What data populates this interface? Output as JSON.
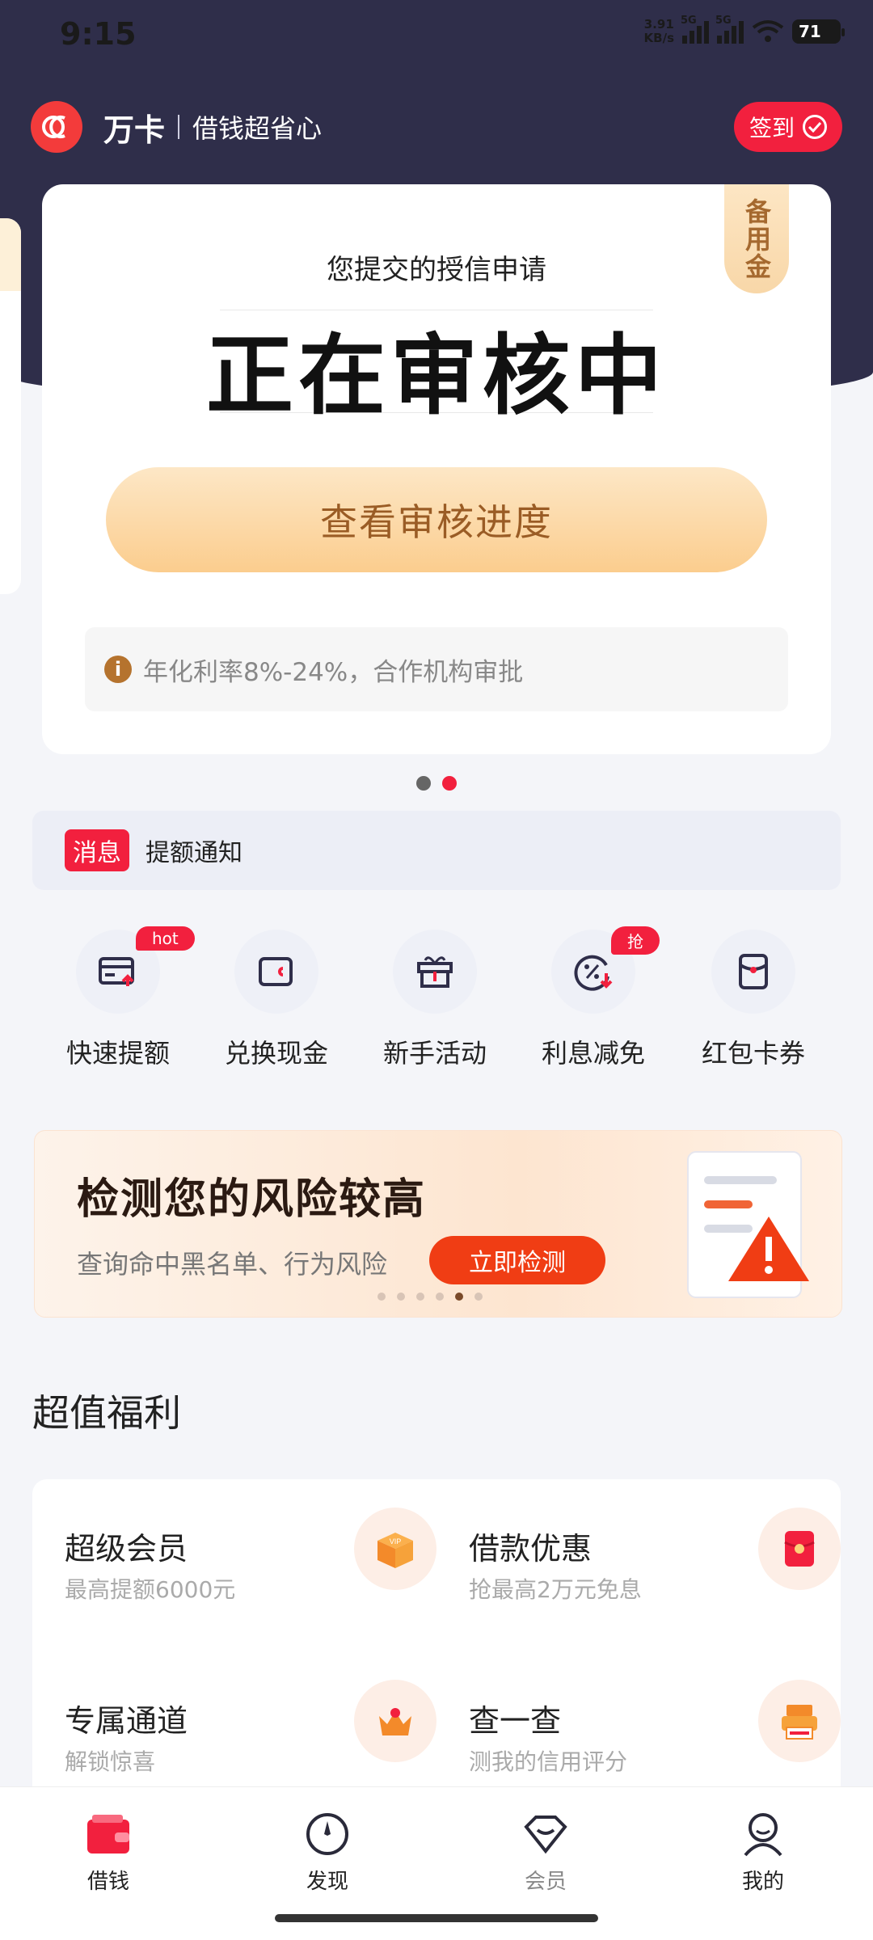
{
  "status_bar": {
    "time": "9:15",
    "net_speed": "3.91\nKB/s",
    "sim1": "5G",
    "sim2": "5G",
    "battery": "71"
  },
  "header": {
    "brand": "万卡",
    "slogan": "借钱超省心",
    "signin_label": "签到"
  },
  "card": {
    "ribbon": "备用金",
    "subtitle": "您提交的授信申请",
    "status": "正在审核中",
    "cta": "查看审核进度",
    "note": "年化利率8%-24%，合作机构审批"
  },
  "message": {
    "tag": "消息",
    "text": "提额通知"
  },
  "quick_actions": [
    {
      "label": "快速提额",
      "badge": "hot"
    },
    {
      "label": "兑换现金"
    },
    {
      "label": "新手活动"
    },
    {
      "label": "利息减免",
      "badge": "抢"
    },
    {
      "label": "红包卡券"
    }
  ],
  "banner": {
    "title": "检测您的风险较高",
    "subtitle": "查询命中黑名单、行为风险",
    "button": "立即检测",
    "dots_total": 6,
    "dot_active": 5
  },
  "section_title": "超值福利",
  "benefits": [
    {
      "title": "超级会员",
      "desc": "最高提额6000元",
      "icon": "vip-box-icon"
    },
    {
      "title": "借款优惠",
      "desc": "抢最高2万元免息",
      "icon": "red-envelope-icon"
    },
    {
      "title": "专属通道",
      "desc": "解锁惊喜",
      "icon": "crown-icon"
    },
    {
      "title": "查一查",
      "desc": "测我的信用评分",
      "icon": "credit-report-icon"
    }
  ],
  "tabs": [
    {
      "label": "借钱",
      "icon": "wallet-icon",
      "active": true
    },
    {
      "label": "发现",
      "icon": "compass-icon"
    },
    {
      "label": "会员",
      "icon": "diamond-icon"
    },
    {
      "label": "我的",
      "icon": "user-icon"
    }
  ],
  "colors": {
    "header_bg": "#2f2e4a",
    "accent_red": "#f2203e",
    "gold": "#fbcd8e"
  }
}
